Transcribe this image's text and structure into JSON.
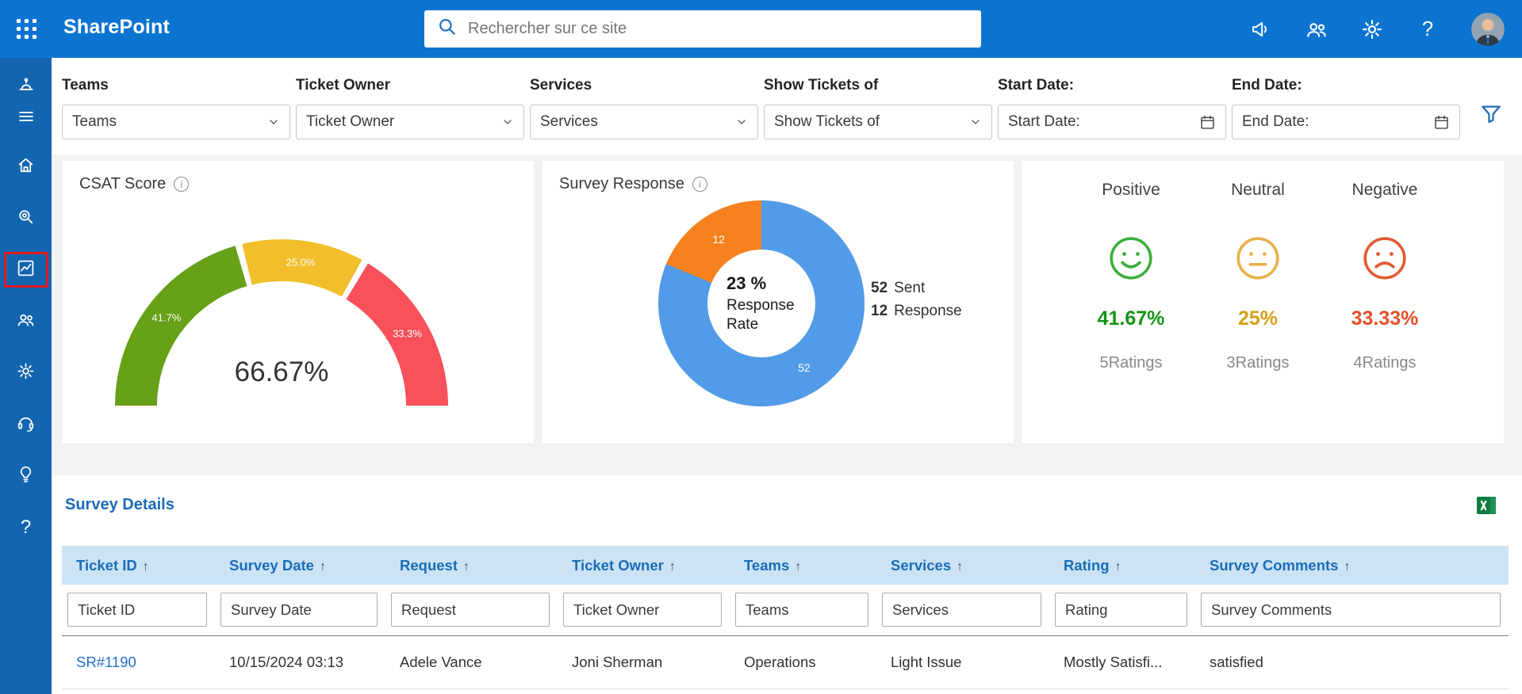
{
  "topbar": {
    "app_name": "SharePoint",
    "search_placeholder": "Rechercher sur ce site"
  },
  "glyphs": {
    "info": "i",
    "question": "?"
  },
  "theme": {
    "topbar_blue": "#0B74D1",
    "sidebar_blue": "#1365AF",
    "highlight_red": "#E01B24",
    "link_blue": "#2470C9",
    "table_header_bg": "#CBE3F5",
    "table_header_text": "#1A6CB8",
    "excel_green": "#107C41"
  },
  "filters": [
    {
      "label": "Teams",
      "value": "Teams"
    },
    {
      "label": "Ticket Owner",
      "value": "Ticket Owner"
    },
    {
      "label": "Services",
      "value": "Services"
    },
    {
      "label": "Show Tickets of",
      "value": "Show Tickets of"
    },
    {
      "label": "Start Date:",
      "value": "Start Date:"
    },
    {
      "label": "End Date:",
      "value": "End Date:"
    }
  ],
  "cards": {
    "csat": {
      "title": "CSAT Score",
      "center_value": "66.67%",
      "chart": {
        "type": "gauge",
        "segments": [
          {
            "label": "41.7%",
            "value": 41.7,
            "color": "#66A117"
          },
          {
            "label": "25.0%",
            "value": 25.0,
            "color": "#F2BE2B"
          },
          {
            "label": "33.3%",
            "value": 33.3,
            "color": "#F9515C"
          }
        ]
      }
    },
    "survey_response": {
      "title": "Survey Response",
      "center_value": "23 %",
      "center_label": "Response Rate",
      "chart": {
        "type": "donut",
        "slices": [
          {
            "label": "52",
            "value": 52,
            "color": "#529BE8",
            "legend_value": "52",
            "legend_label": "Sent"
          },
          {
            "label": "12",
            "value": 12,
            "color": "#F5821F",
            "legend_value": "12",
            "legend_label": "Response"
          }
        ]
      }
    },
    "sentiment": {
      "items": [
        {
          "label": "Positive",
          "percent": "41.67%",
          "ratings": "5Ratings",
          "percent_color": "#159415",
          "icon_color": "#3CAE3C",
          "icon": "smile"
        },
        {
          "label": "Neutral",
          "percent": "25%",
          "ratings": "3Ratings",
          "percent_color": "#D4A017",
          "icon_color": "#E8B04B",
          "icon": "neutral"
        },
        {
          "label": "Negative",
          "percent": "33.33%",
          "ratings": "4Ratings",
          "percent_color": "#E1502A",
          "icon_color": "#E05A33",
          "icon": "frown"
        }
      ]
    }
  },
  "survey_details": {
    "title": "Survey Details",
    "sort_icon": "↑",
    "columns": [
      "Ticket ID",
      "Survey Date",
      "Request",
      "Ticket Owner",
      "Teams",
      "Services",
      "Rating",
      "Survey Comments"
    ],
    "filter_placeholders": [
      "Ticket ID",
      "Survey Date",
      "Request",
      "Ticket Owner",
      "Teams",
      "Services",
      "Rating",
      "Survey Comments"
    ],
    "rows": [
      {
        "ticket_id": "SR#1190",
        "survey_date": "10/15/2024 03:13",
        "request": "Adele Vance",
        "ticket_owner": "Joni Sherman",
        "teams": "Operations",
        "services": "Light Issue",
        "rating": "Mostly Satisfi...",
        "comments": "satisfied"
      }
    ]
  }
}
